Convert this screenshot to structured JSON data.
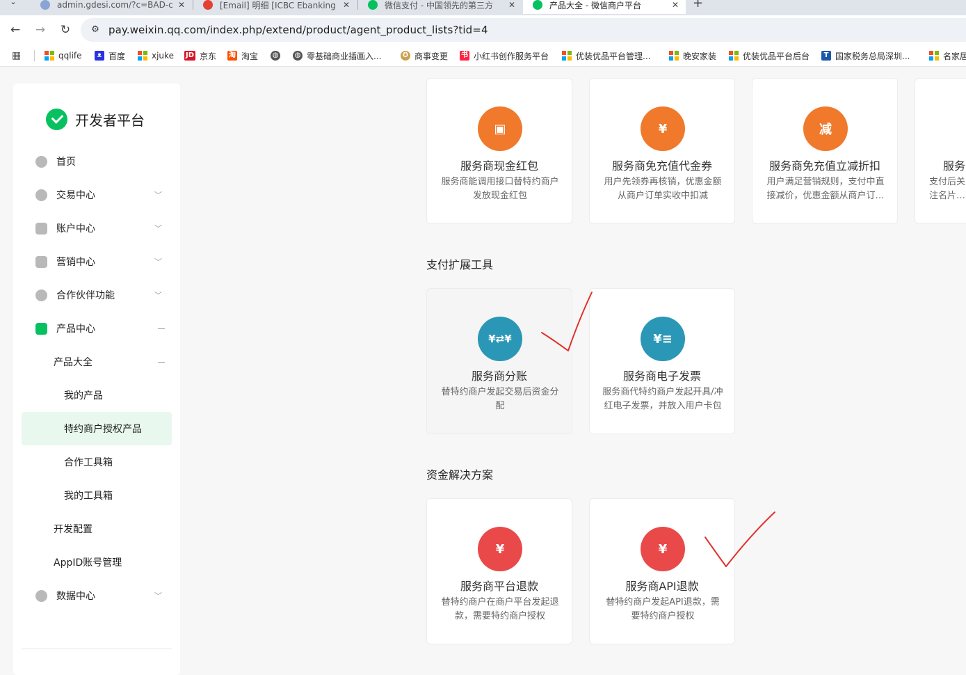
{
  "browser": {
    "tabs": [
      {
        "title": "admin.gdesi.com/?c=BAD-c",
        "color": "#8aa4d6"
      },
      {
        "title": "[Email] 明细 [ICBC Ebanking",
        "color": "#e34133"
      },
      {
        "title": "微信支付 - 中国领先的第三方",
        "color": "#07c160"
      },
      {
        "title": "产品大全 - 微信商户平台",
        "color": "#07c160"
      }
    ],
    "new_tab": "+",
    "url": "pay.weixin.qq.com/index.php/extend/product/agent_product_lists?tid=4",
    "bookmarks": [
      {
        "label": "qqlife",
        "icon": "ms-logo-icon"
      },
      {
        "label": "百度",
        "icon": "baidu-icon",
        "color": "#2932e1"
      },
      {
        "label": "xjuke",
        "icon": "ms-logo-icon"
      },
      {
        "label": "京东",
        "icon": "jd-icon",
        "color": "#d7152a",
        "glyph": "JD"
      },
      {
        "label": "淘宝",
        "icon": "taobao-icon",
        "color": "#ff5000",
        "glyph": "淘"
      },
      {
        "label": "",
        "icon": "globe-icon"
      },
      {
        "label": "零基础商业插画入...",
        "icon": "globe-icon"
      },
      {
        "label": "商事变更",
        "icon": "emblem-icon"
      },
      {
        "label": "小红书创作服务平台",
        "icon": "xhs-icon",
        "color": "#ff2442"
      },
      {
        "label": "优装优品平台管理...",
        "icon": "ms-logo-icon"
      },
      {
        "label": "晚安家装",
        "icon": "ms-logo-icon"
      },
      {
        "label": "优装优品平台后台",
        "icon": "ms-logo-icon"
      },
      {
        "label": "国家税务总局深圳...",
        "icon": "tax-icon"
      },
      {
        "label": "名家居",
        "icon": "ms-logo-icon"
      }
    ]
  },
  "sidebar": {
    "brand": "开发者平台",
    "items": [
      {
        "label": "首页",
        "icon": "home-icon",
        "level": 0,
        "chevron": false
      },
      {
        "label": "交易中心",
        "icon": "transaction-icon",
        "level": 0,
        "chevron": true
      },
      {
        "label": "账户中心",
        "icon": "account-icon",
        "level": 0,
        "chevron": true
      },
      {
        "label": "营销中心",
        "icon": "marketing-icon",
        "level": 0,
        "chevron": true
      },
      {
        "label": "合作伙伴功能",
        "icon": "partner-icon",
        "level": 0,
        "chevron": true
      },
      {
        "label": "产品中心",
        "icon": "product-icon",
        "level": 0,
        "expanded": true
      },
      {
        "label": "产品大全",
        "level": 1,
        "expanded": true
      },
      {
        "label": "我的产品",
        "level": 2
      },
      {
        "label": "特约商户授权产品",
        "level": 2,
        "active": true
      },
      {
        "label": "合作工具箱",
        "level": 2
      },
      {
        "label": "我的工具箱",
        "level": 2
      },
      {
        "label": "开发配置",
        "level": 1
      },
      {
        "label": "AppID账号管理",
        "level": 1
      },
      {
        "label": "数据中心",
        "icon": "data-icon",
        "level": 0,
        "chevron": true
      }
    ]
  },
  "main": {
    "top_cards": [
      {
        "title": "服务商现金红包",
        "desc": "服务商能调用接口替特约商户发放现金红包",
        "icon": "red-packet-icon",
        "glyph": "▣",
        "color": "#f0792b"
      },
      {
        "title": "服务商免充值代金券",
        "desc": "用户先领券再核销，优惠金额从商户订单实收中扣减",
        "icon": "voucher-icon",
        "glyph": "¥",
        "color": "#f0792b"
      },
      {
        "title": "服务商免充值立减折扣",
        "desc": "用户满足营销规则，支付中直接减价，优惠金额从商户订单实收中扣减",
        "icon": "discount-icon",
        "glyph": "减",
        "color": "#f0792b"
      },
      {
        "title": "服务",
        "desc": "支付后关注名片，推",
        "icon": "service-icon",
        "glyph": "",
        "color": "#f0792b"
      }
    ],
    "sections": [
      {
        "title": "支付扩展工具",
        "cards": [
          {
            "title": "服务商分账",
            "desc": "替特约商户发起交易后资金分配",
            "icon": "split-icon",
            "glyph": "¥⇄¥",
            "color": "#2b97b6",
            "hover": true
          },
          {
            "title": "服务商电子发票",
            "desc": "服务商代特约商户发起开具/冲红电子发票，并放入用户卡包",
            "icon": "invoice-icon",
            "glyph": "¥≡",
            "color": "#2b97b6"
          }
        ]
      },
      {
        "title": "资金解决方案",
        "cards": [
          {
            "title": "服务商平台退款",
            "desc": "替特约商户在商户平台发起退款，需要特约商户授权",
            "icon": "refund-icon",
            "glyph": "¥",
            "color": "#e94a49"
          },
          {
            "title": "服务商API退款",
            "desc": "替特约商户发起API退款，需要特约商户授权",
            "icon": "api-refund-icon",
            "glyph": "¥",
            "color": "#e94a49"
          }
        ]
      }
    ]
  }
}
